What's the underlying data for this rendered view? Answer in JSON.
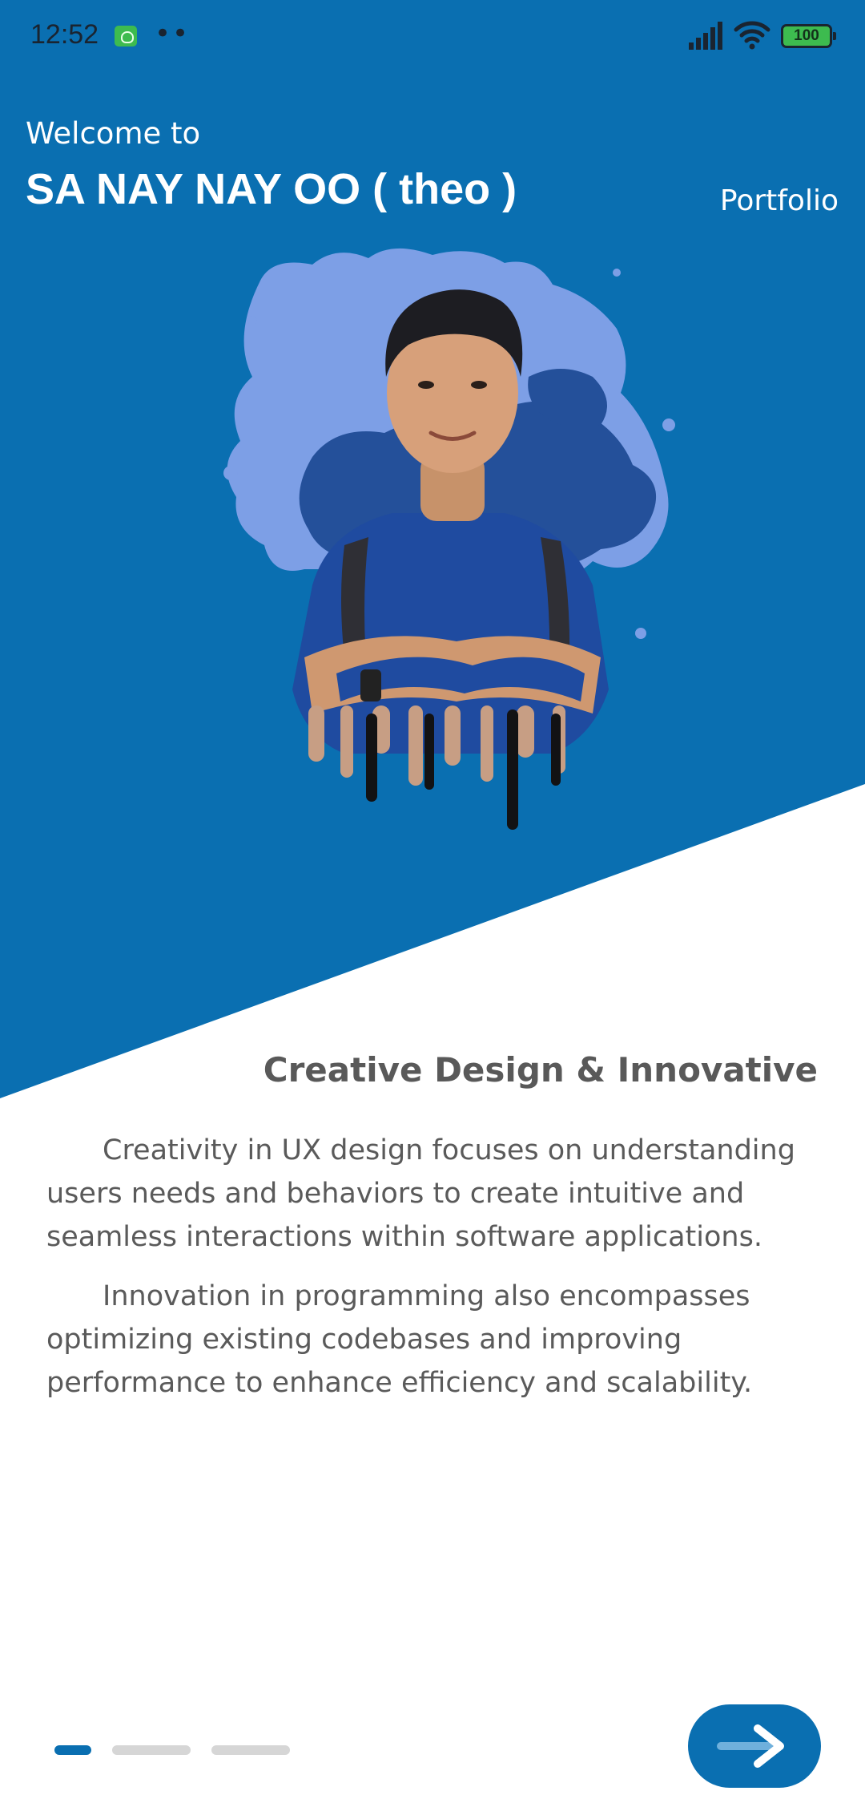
{
  "status_bar": {
    "time": "12:52",
    "notification_dots": "••",
    "battery_level": "100",
    "icons": [
      "android-notification-icon",
      "signal-icon",
      "wifi-icon",
      "battery-icon"
    ]
  },
  "header": {
    "welcome": "Welcome to",
    "name": "SA NAY NAY OO ( theo )",
    "portfolio_link": "Portfolio"
  },
  "content": {
    "title": "Creative Design & Innovative",
    "paragraphs": [
      "Creativity in UX design focuses on understanding users needs and behaviors to create intuitive and seamless interactions within software applications.",
      "Innovation in programming also encompasses optimizing existing codebases and improving performance to enhance efficiency and scalability."
    ]
  },
  "pager": {
    "total_pages": 3,
    "active_index": 0
  },
  "colors": {
    "primary": "#0a6fb1",
    "splash_light": "#7d9fe6",
    "splash_dark": "#24509a",
    "text": "#5a5a5a",
    "indicator_inactive": "#d6d6d6"
  },
  "icons": {
    "next_button": "arrow-right-icon"
  }
}
